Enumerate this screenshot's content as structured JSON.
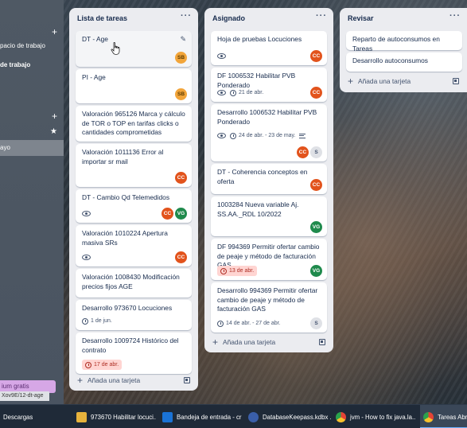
{
  "sidebar": {
    "items": [
      {
        "label": "pacio de trabajo",
        "plus": "+"
      },
      {
        "label": "de trabajo"
      },
      {
        "label": "ayo",
        "active": true
      }
    ],
    "promo": "ium gratis",
    "status_url": "Xov9E/12-dt-age"
  },
  "lists": [
    {
      "title": "Lista de tareas",
      "cards": [
        {
          "title": "DT - Age",
          "members": [
            "SB"
          ]
        },
        {
          "title": "PI - Age",
          "members": [
            "SB"
          ]
        },
        {
          "title": "Valoración 965126 Marca y cálculo de TOR o TOP en tarifas clicks o cantidades comprometidas"
        },
        {
          "title": "Valoración 1011136 Error al importar sr mail",
          "members": [
            "CC"
          ]
        },
        {
          "title": "DT - Cambio Qd Telemedidos",
          "members": [
            "CC",
            "VG"
          ]
        },
        {
          "title": "Valoración 1010224 Apertura masiva SRs",
          "members": [
            "CC"
          ]
        },
        {
          "title": "Valoración 1008430 Modificación precios fijos AGE"
        },
        {
          "title": "Desarrollo 973670 Locuciones",
          "date": "1 de jun."
        },
        {
          "title": "Desarrollo 1009724 Histórico del contrato",
          "date": "17 de abr."
        }
      ],
      "add_label": "Añada una tarjeta"
    },
    {
      "title": "Asignado",
      "cards": [
        {
          "title": "Hoja de pruebas Locuciones",
          "members": [
            "CC"
          ]
        },
        {
          "title": "DF 1006532 Habilitar PVB Ponderado",
          "date": "21 de abr.",
          "members": [
            "CC"
          ]
        },
        {
          "title": "Desarrollo 1006532 Habilitar PVB Ponderado",
          "date": "24 de abr. - 23 de may.",
          "members": [
            "CC",
            "S"
          ]
        },
        {
          "title": "DT - Coherencia conceptos en oferta",
          "members": [
            "CC"
          ]
        },
        {
          "title": "1003284 Nueva variable Aj. SS.AA._RDL 10/2022",
          "members": [
            "VG"
          ]
        },
        {
          "title": "DF 994369 Permitir ofertar cambio de peaje y método de facturación GAS",
          "date": "13 de abr.",
          "members": [
            "VG"
          ]
        },
        {
          "title": "Desarrollo 994369 Permitir ofertar cambio de peaje y método de facturación GAS",
          "date": "14 de abr. - 27 de abr.",
          "members": [
            "S"
          ]
        }
      ],
      "add_label": "Añada una tarjeta"
    },
    {
      "title": "Revisar",
      "cards": [
        {
          "title": "Reparto de autoconsumos en Tareas"
        },
        {
          "title": "Desarrollo autoconsumos"
        }
      ],
      "add_label": "Añada una tarjeta"
    }
  ],
  "menu_glyph": "···",
  "taskbar": [
    {
      "label": "Descargas"
    },
    {
      "label": "973670 Habilitar locuci..."
    },
    {
      "label": "Bandeja de entrada - cri..."
    },
    {
      "label": "DatabaseKeepass.kdbx ..."
    },
    {
      "label": "jvm - How to fix java.la..."
    },
    {
      "label": "Tareas Abril-M..."
    }
  ],
  "colors": {
    "cc": "#e2531c",
    "sb": "#f2a53a",
    "vg": "#1f8a4c",
    "due": "#ffd5d2"
  }
}
